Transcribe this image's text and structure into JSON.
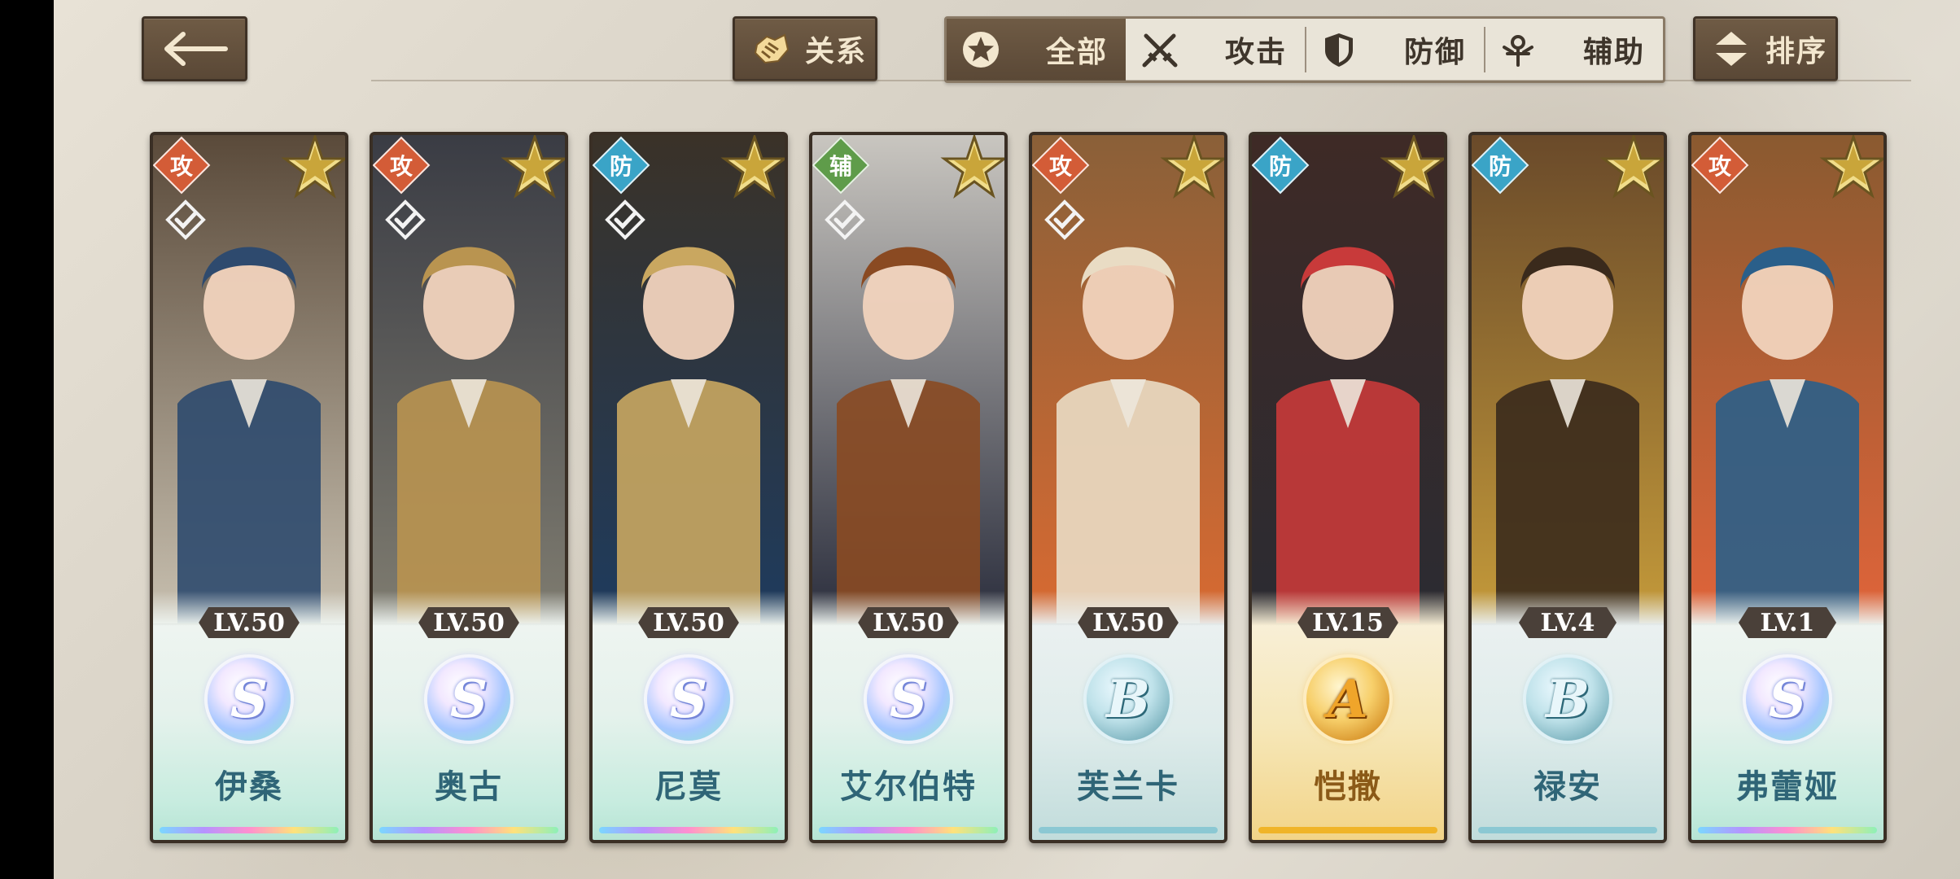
{
  "topbar": {
    "relation_label": "关系",
    "sort_label": "排序",
    "filters": [
      {
        "label": "全部",
        "icon": "star-circle-icon",
        "active": true
      },
      {
        "label": "攻击",
        "icon": "crossed-swords-icon",
        "active": false
      },
      {
        "label": "防御",
        "icon": "shield-icon",
        "active": false
      },
      {
        "label": "辅助",
        "icon": "support-emblem-icon",
        "active": false
      }
    ]
  },
  "characters": [
    {
      "name": "伊桑",
      "level": "LV.50",
      "role": "攻",
      "rank": "S",
      "style": "rainbow",
      "checked": true,
      "palette": [
        "#5a4a3a",
        "#c8c0b0",
        "#2e4a6e"
      ]
    },
    {
      "name": "奥古",
      "level": "LV.50",
      "role": "攻",
      "rank": "S",
      "style": "rainbow",
      "checked": true,
      "palette": [
        "#3a3c44",
        "#7f7c70",
        "#b99450"
      ]
    },
    {
      "name": "尼莫",
      "level": "LV.50",
      "role": "防",
      "rank": "S",
      "style": "rainbow",
      "checked": true,
      "palette": [
        "#3a3228",
        "#1e3b5e",
        "#c9a760"
      ]
    },
    {
      "name": "艾尔伯特",
      "level": "LV.50",
      "role": "辅",
      "rank": "S",
      "style": "rainbow",
      "checked": true,
      "palette": [
        "#c9c6c0",
        "#2a2d3c",
        "#8a4a22"
      ]
    },
    {
      "name": "芙兰卡",
      "level": "LV.50",
      "role": "攻",
      "rank": "B",
      "style": "blue",
      "checked": true,
      "palette": [
        "#8a6038",
        "#d86a32",
        "#e9dcc4"
      ]
    },
    {
      "name": "恺撒",
      "level": "LV.15",
      "role": "防",
      "rank": "A",
      "style": "gold",
      "checked": false,
      "palette": [
        "#3e2a26",
        "#2b2b32",
        "#c83a3a"
      ]
    },
    {
      "name": "禄安",
      "level": "LV.4",
      "role": "防",
      "rank": "B",
      "style": "blue",
      "checked": false,
      "palette": [
        "#6a4a2a",
        "#c49a3a",
        "#3a2a1c"
      ]
    },
    {
      "name": "弗蕾娅",
      "level": "LV.1",
      "role": "攻",
      "rank": "S",
      "style": "rainbow",
      "checked": false,
      "palette": [
        "#8a5a30",
        "#e0643a",
        "#2a5f8a"
      ]
    }
  ]
}
